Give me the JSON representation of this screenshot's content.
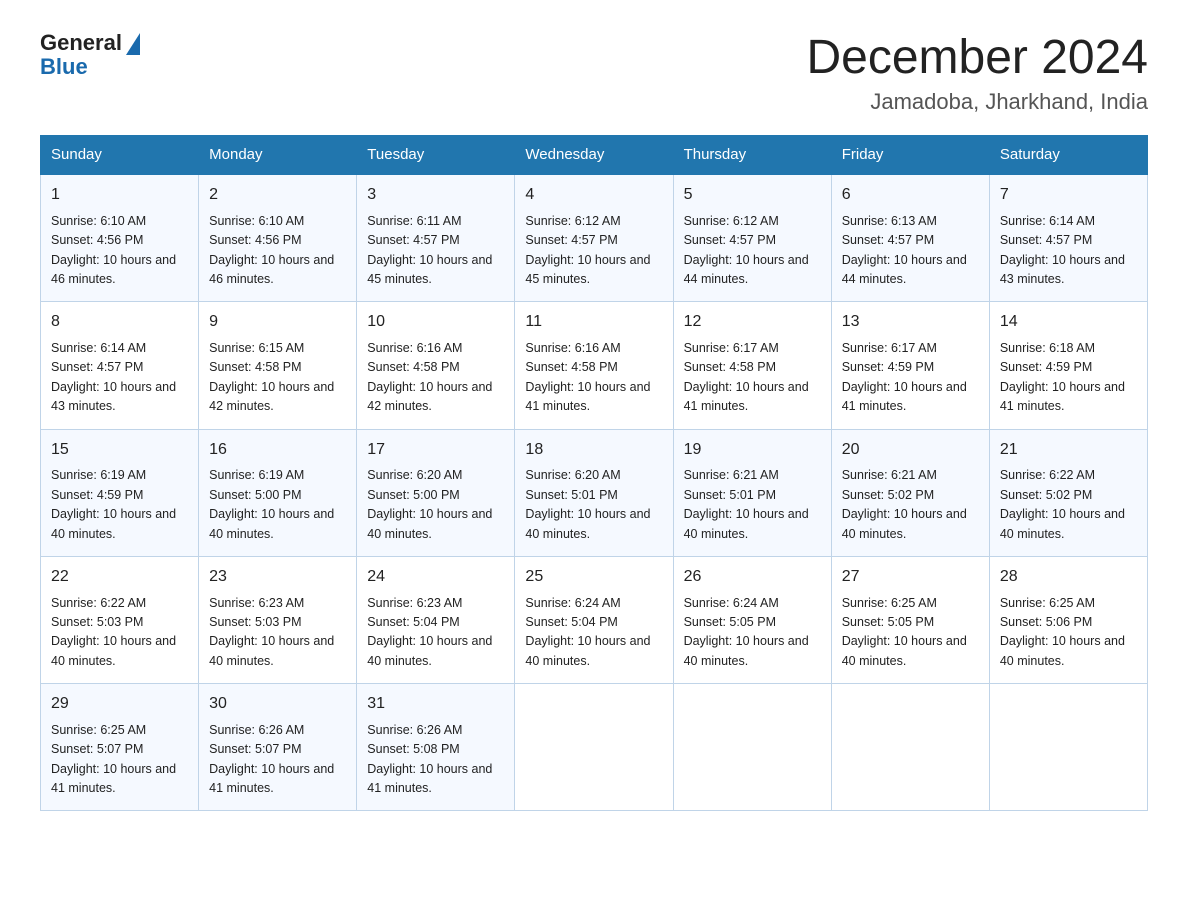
{
  "header": {
    "logo_general": "General",
    "logo_blue": "Blue",
    "month_title": "December 2024",
    "location": "Jamadoba, Jharkhand, India"
  },
  "weekdays": [
    "Sunday",
    "Monday",
    "Tuesday",
    "Wednesday",
    "Thursday",
    "Friday",
    "Saturday"
  ],
  "weeks": [
    [
      {
        "day": "1",
        "sunrise": "6:10 AM",
        "sunset": "4:56 PM",
        "daylight": "10 hours and 46 minutes."
      },
      {
        "day": "2",
        "sunrise": "6:10 AM",
        "sunset": "4:56 PM",
        "daylight": "10 hours and 46 minutes."
      },
      {
        "day": "3",
        "sunrise": "6:11 AM",
        "sunset": "4:57 PM",
        "daylight": "10 hours and 45 minutes."
      },
      {
        "day": "4",
        "sunrise": "6:12 AM",
        "sunset": "4:57 PM",
        "daylight": "10 hours and 45 minutes."
      },
      {
        "day": "5",
        "sunrise": "6:12 AM",
        "sunset": "4:57 PM",
        "daylight": "10 hours and 44 minutes."
      },
      {
        "day": "6",
        "sunrise": "6:13 AM",
        "sunset": "4:57 PM",
        "daylight": "10 hours and 44 minutes."
      },
      {
        "day": "7",
        "sunrise": "6:14 AM",
        "sunset": "4:57 PM",
        "daylight": "10 hours and 43 minutes."
      }
    ],
    [
      {
        "day": "8",
        "sunrise": "6:14 AM",
        "sunset": "4:57 PM",
        "daylight": "10 hours and 43 minutes."
      },
      {
        "day": "9",
        "sunrise": "6:15 AM",
        "sunset": "4:58 PM",
        "daylight": "10 hours and 42 minutes."
      },
      {
        "day": "10",
        "sunrise": "6:16 AM",
        "sunset": "4:58 PM",
        "daylight": "10 hours and 42 minutes."
      },
      {
        "day": "11",
        "sunrise": "6:16 AM",
        "sunset": "4:58 PM",
        "daylight": "10 hours and 41 minutes."
      },
      {
        "day": "12",
        "sunrise": "6:17 AM",
        "sunset": "4:58 PM",
        "daylight": "10 hours and 41 minutes."
      },
      {
        "day": "13",
        "sunrise": "6:17 AM",
        "sunset": "4:59 PM",
        "daylight": "10 hours and 41 minutes."
      },
      {
        "day": "14",
        "sunrise": "6:18 AM",
        "sunset": "4:59 PM",
        "daylight": "10 hours and 41 minutes."
      }
    ],
    [
      {
        "day": "15",
        "sunrise": "6:19 AM",
        "sunset": "4:59 PM",
        "daylight": "10 hours and 40 minutes."
      },
      {
        "day": "16",
        "sunrise": "6:19 AM",
        "sunset": "5:00 PM",
        "daylight": "10 hours and 40 minutes."
      },
      {
        "day": "17",
        "sunrise": "6:20 AM",
        "sunset": "5:00 PM",
        "daylight": "10 hours and 40 minutes."
      },
      {
        "day": "18",
        "sunrise": "6:20 AM",
        "sunset": "5:01 PM",
        "daylight": "10 hours and 40 minutes."
      },
      {
        "day": "19",
        "sunrise": "6:21 AM",
        "sunset": "5:01 PM",
        "daylight": "10 hours and 40 minutes."
      },
      {
        "day": "20",
        "sunrise": "6:21 AM",
        "sunset": "5:02 PM",
        "daylight": "10 hours and 40 minutes."
      },
      {
        "day": "21",
        "sunrise": "6:22 AM",
        "sunset": "5:02 PM",
        "daylight": "10 hours and 40 minutes."
      }
    ],
    [
      {
        "day": "22",
        "sunrise": "6:22 AM",
        "sunset": "5:03 PM",
        "daylight": "10 hours and 40 minutes."
      },
      {
        "day": "23",
        "sunrise": "6:23 AM",
        "sunset": "5:03 PM",
        "daylight": "10 hours and 40 minutes."
      },
      {
        "day": "24",
        "sunrise": "6:23 AM",
        "sunset": "5:04 PM",
        "daylight": "10 hours and 40 minutes."
      },
      {
        "day": "25",
        "sunrise": "6:24 AM",
        "sunset": "5:04 PM",
        "daylight": "10 hours and 40 minutes."
      },
      {
        "day": "26",
        "sunrise": "6:24 AM",
        "sunset": "5:05 PM",
        "daylight": "10 hours and 40 minutes."
      },
      {
        "day": "27",
        "sunrise": "6:25 AM",
        "sunset": "5:05 PM",
        "daylight": "10 hours and 40 minutes."
      },
      {
        "day": "28",
        "sunrise": "6:25 AM",
        "sunset": "5:06 PM",
        "daylight": "10 hours and 40 minutes."
      }
    ],
    [
      {
        "day": "29",
        "sunrise": "6:25 AM",
        "sunset": "5:07 PM",
        "daylight": "10 hours and 41 minutes."
      },
      {
        "day": "30",
        "sunrise": "6:26 AM",
        "sunset": "5:07 PM",
        "daylight": "10 hours and 41 minutes."
      },
      {
        "day": "31",
        "sunrise": "6:26 AM",
        "sunset": "5:08 PM",
        "daylight": "10 hours and 41 minutes."
      },
      null,
      null,
      null,
      null
    ]
  ]
}
